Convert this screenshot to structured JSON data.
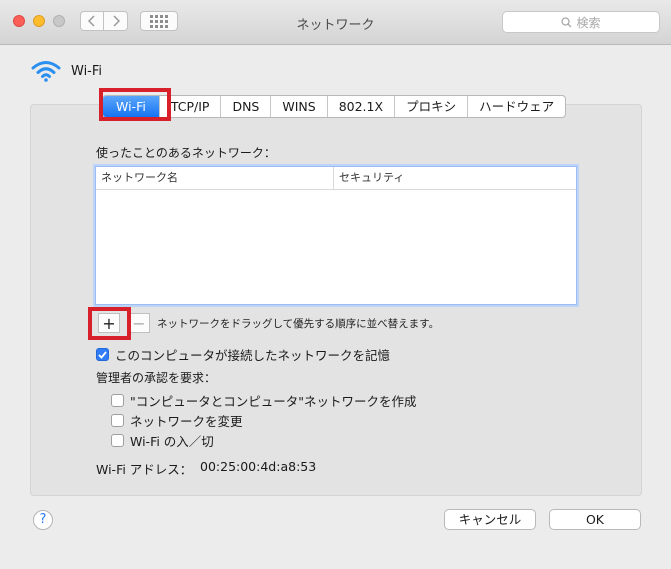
{
  "window": {
    "title": "ネットワーク"
  },
  "toolbar": {
    "back_icon": "chevron-left",
    "forward_icon": "chevron-right",
    "grid_icon": "grid-icon"
  },
  "search": {
    "placeholder": "検索"
  },
  "header": {
    "label": "Wi-Fi"
  },
  "tabs": [
    "Wi-Fi",
    "TCP/IP",
    "DNS",
    "WINS",
    "802.1X",
    "プロキシ",
    "ハードウェア"
  ],
  "active_tab": "Wi-Fi",
  "networks": {
    "heading": "使ったことのあるネットワーク：",
    "columns": [
      "ネットワーク名",
      "セキュリティ"
    ],
    "rows": [],
    "add_label": "+",
    "remove_label": "−",
    "hint": "ネットワークをドラッグして優先する順序に並べ替えます。"
  },
  "remember": {
    "label": "このコンピュータが接続したネットワークを記憶",
    "checked": true
  },
  "admin": {
    "heading": "管理者の承認を要求：",
    "options": [
      {
        "label": "\"コンピュータとコンピュータ\"ネットワークを作成",
        "checked": false
      },
      {
        "label": "ネットワークを変更",
        "checked": false
      },
      {
        "label": "Wi-Fi の入／切",
        "checked": false
      }
    ]
  },
  "address": {
    "label": "Wi-Fi アドレス：",
    "value": "00:25:00:4d:a8:53"
  },
  "footer": {
    "help": "?",
    "cancel": "キャンセル",
    "ok": "OK"
  },
  "colors": {
    "accent": "#1673f3",
    "highlight": "#d8202b"
  }
}
